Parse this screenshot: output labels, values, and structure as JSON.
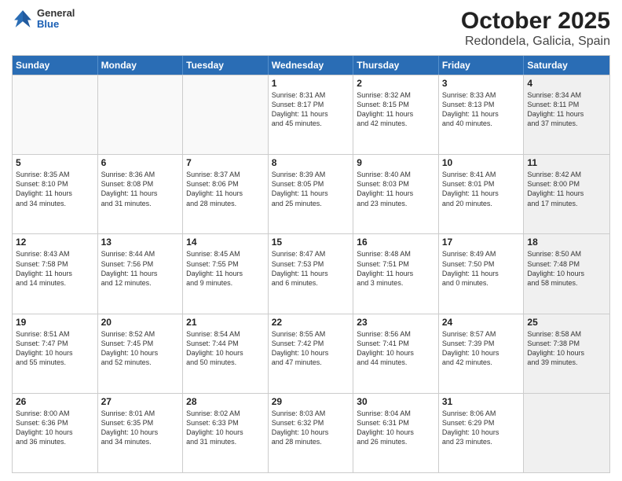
{
  "header": {
    "logo_general": "General",
    "logo_blue": "Blue",
    "title": "October 2025",
    "subtitle": "Redondela, Galicia, Spain"
  },
  "days_of_week": [
    "Sunday",
    "Monday",
    "Tuesday",
    "Wednesday",
    "Thursday",
    "Friday",
    "Saturday"
  ],
  "weeks": [
    [
      {
        "day": "",
        "text": "",
        "empty": true
      },
      {
        "day": "",
        "text": "",
        "empty": true
      },
      {
        "day": "",
        "text": "",
        "empty": true
      },
      {
        "day": "1",
        "text": "Sunrise: 8:31 AM\nSunset: 8:17 PM\nDaylight: 11 hours\nand 45 minutes.",
        "empty": false
      },
      {
        "day": "2",
        "text": "Sunrise: 8:32 AM\nSunset: 8:15 PM\nDaylight: 11 hours\nand 42 minutes.",
        "empty": false
      },
      {
        "day": "3",
        "text": "Sunrise: 8:33 AM\nSunset: 8:13 PM\nDaylight: 11 hours\nand 40 minutes.",
        "empty": false
      },
      {
        "day": "4",
        "text": "Sunrise: 8:34 AM\nSunset: 8:11 PM\nDaylight: 11 hours\nand 37 minutes.",
        "empty": false,
        "shaded": true
      }
    ],
    [
      {
        "day": "5",
        "text": "Sunrise: 8:35 AM\nSunset: 8:10 PM\nDaylight: 11 hours\nand 34 minutes.",
        "empty": false
      },
      {
        "day": "6",
        "text": "Sunrise: 8:36 AM\nSunset: 8:08 PM\nDaylight: 11 hours\nand 31 minutes.",
        "empty": false
      },
      {
        "day": "7",
        "text": "Sunrise: 8:37 AM\nSunset: 8:06 PM\nDaylight: 11 hours\nand 28 minutes.",
        "empty": false
      },
      {
        "day": "8",
        "text": "Sunrise: 8:39 AM\nSunset: 8:05 PM\nDaylight: 11 hours\nand 25 minutes.",
        "empty": false
      },
      {
        "day": "9",
        "text": "Sunrise: 8:40 AM\nSunset: 8:03 PM\nDaylight: 11 hours\nand 23 minutes.",
        "empty": false
      },
      {
        "day": "10",
        "text": "Sunrise: 8:41 AM\nSunset: 8:01 PM\nDaylight: 11 hours\nand 20 minutes.",
        "empty": false
      },
      {
        "day": "11",
        "text": "Sunrise: 8:42 AM\nSunset: 8:00 PM\nDaylight: 11 hours\nand 17 minutes.",
        "empty": false,
        "shaded": true
      }
    ],
    [
      {
        "day": "12",
        "text": "Sunrise: 8:43 AM\nSunset: 7:58 PM\nDaylight: 11 hours\nand 14 minutes.",
        "empty": false
      },
      {
        "day": "13",
        "text": "Sunrise: 8:44 AM\nSunset: 7:56 PM\nDaylight: 11 hours\nand 12 minutes.",
        "empty": false
      },
      {
        "day": "14",
        "text": "Sunrise: 8:45 AM\nSunset: 7:55 PM\nDaylight: 11 hours\nand 9 minutes.",
        "empty": false
      },
      {
        "day": "15",
        "text": "Sunrise: 8:47 AM\nSunset: 7:53 PM\nDaylight: 11 hours\nand 6 minutes.",
        "empty": false
      },
      {
        "day": "16",
        "text": "Sunrise: 8:48 AM\nSunset: 7:51 PM\nDaylight: 11 hours\nand 3 minutes.",
        "empty": false
      },
      {
        "day": "17",
        "text": "Sunrise: 8:49 AM\nSunset: 7:50 PM\nDaylight: 11 hours\nand 0 minutes.",
        "empty": false
      },
      {
        "day": "18",
        "text": "Sunrise: 8:50 AM\nSunset: 7:48 PM\nDaylight: 10 hours\nand 58 minutes.",
        "empty": false,
        "shaded": true
      }
    ],
    [
      {
        "day": "19",
        "text": "Sunrise: 8:51 AM\nSunset: 7:47 PM\nDaylight: 10 hours\nand 55 minutes.",
        "empty": false
      },
      {
        "day": "20",
        "text": "Sunrise: 8:52 AM\nSunset: 7:45 PM\nDaylight: 10 hours\nand 52 minutes.",
        "empty": false
      },
      {
        "day": "21",
        "text": "Sunrise: 8:54 AM\nSunset: 7:44 PM\nDaylight: 10 hours\nand 50 minutes.",
        "empty": false
      },
      {
        "day": "22",
        "text": "Sunrise: 8:55 AM\nSunset: 7:42 PM\nDaylight: 10 hours\nand 47 minutes.",
        "empty": false
      },
      {
        "day": "23",
        "text": "Sunrise: 8:56 AM\nSunset: 7:41 PM\nDaylight: 10 hours\nand 44 minutes.",
        "empty": false
      },
      {
        "day": "24",
        "text": "Sunrise: 8:57 AM\nSunset: 7:39 PM\nDaylight: 10 hours\nand 42 minutes.",
        "empty": false
      },
      {
        "day": "25",
        "text": "Sunrise: 8:58 AM\nSunset: 7:38 PM\nDaylight: 10 hours\nand 39 minutes.",
        "empty": false,
        "shaded": true
      }
    ],
    [
      {
        "day": "26",
        "text": "Sunrise: 8:00 AM\nSunset: 6:36 PM\nDaylight: 10 hours\nand 36 minutes.",
        "empty": false
      },
      {
        "day": "27",
        "text": "Sunrise: 8:01 AM\nSunset: 6:35 PM\nDaylight: 10 hours\nand 34 minutes.",
        "empty": false
      },
      {
        "day": "28",
        "text": "Sunrise: 8:02 AM\nSunset: 6:33 PM\nDaylight: 10 hours\nand 31 minutes.",
        "empty": false
      },
      {
        "day": "29",
        "text": "Sunrise: 8:03 AM\nSunset: 6:32 PM\nDaylight: 10 hours\nand 28 minutes.",
        "empty": false
      },
      {
        "day": "30",
        "text": "Sunrise: 8:04 AM\nSunset: 6:31 PM\nDaylight: 10 hours\nand 26 minutes.",
        "empty": false
      },
      {
        "day": "31",
        "text": "Sunrise: 8:06 AM\nSunset: 6:29 PM\nDaylight: 10 hours\nand 23 minutes.",
        "empty": false
      },
      {
        "day": "",
        "text": "",
        "empty": true,
        "shaded": true
      }
    ]
  ]
}
